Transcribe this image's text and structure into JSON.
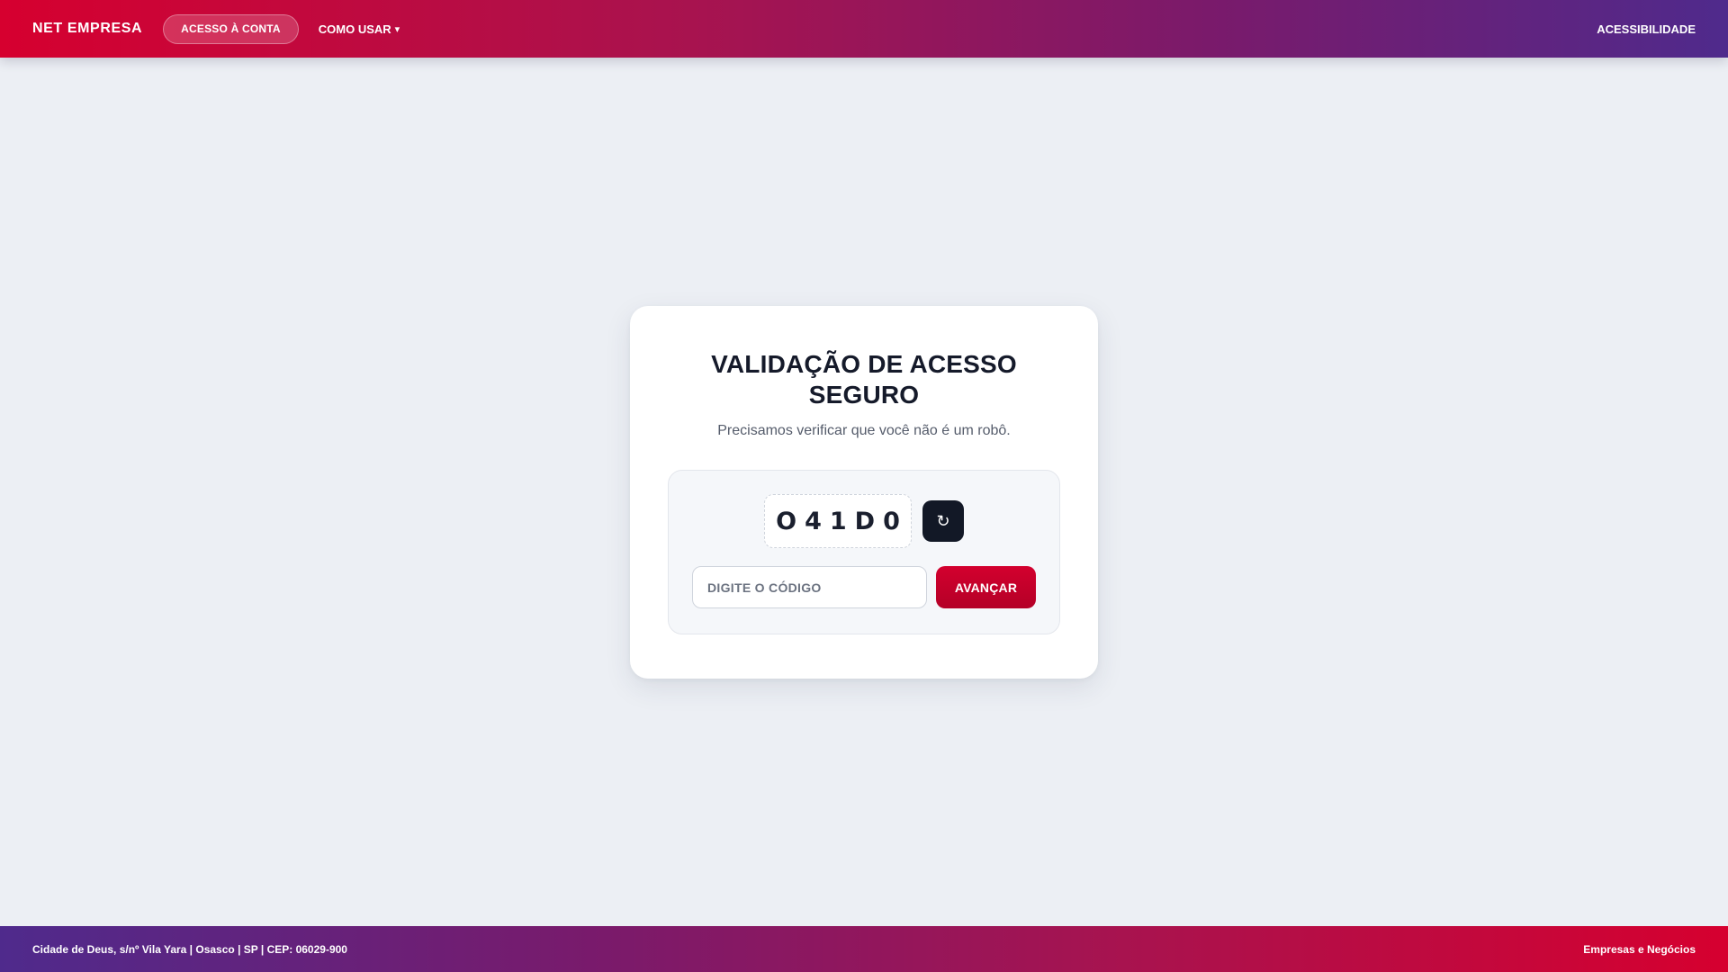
{
  "header": {
    "brand": "NET EMPRESA",
    "nav_pill_label": "ACESSO À CONTA",
    "nav_link_label": "COMO USAR",
    "nav_link_caret": "▾",
    "right_link_label": "ACESSIBILIDADE"
  },
  "card": {
    "title": "VALIDAÇÃO DE ACESSO SEGURO",
    "subtitle": "Precisamos verificar que você não é um robô.",
    "captcha_code": "O41D0",
    "refresh_icon": "refresh-icon",
    "refresh_glyph": "↻",
    "input_placeholder": "DIGITE O CÓDIGO",
    "input_value": "",
    "submit_label": "AVANÇAR"
  },
  "footer": {
    "address": "Cidade de Deus, s/nº Vila Yara | Osasco | SP | CEP: 06029-900",
    "right_label": "Empresas e Negócios"
  },
  "colors": {
    "brand_red": "#d6002f",
    "brand_purple": "#4f2a8c",
    "button_dark": "#121826",
    "background": "#eceff4"
  }
}
